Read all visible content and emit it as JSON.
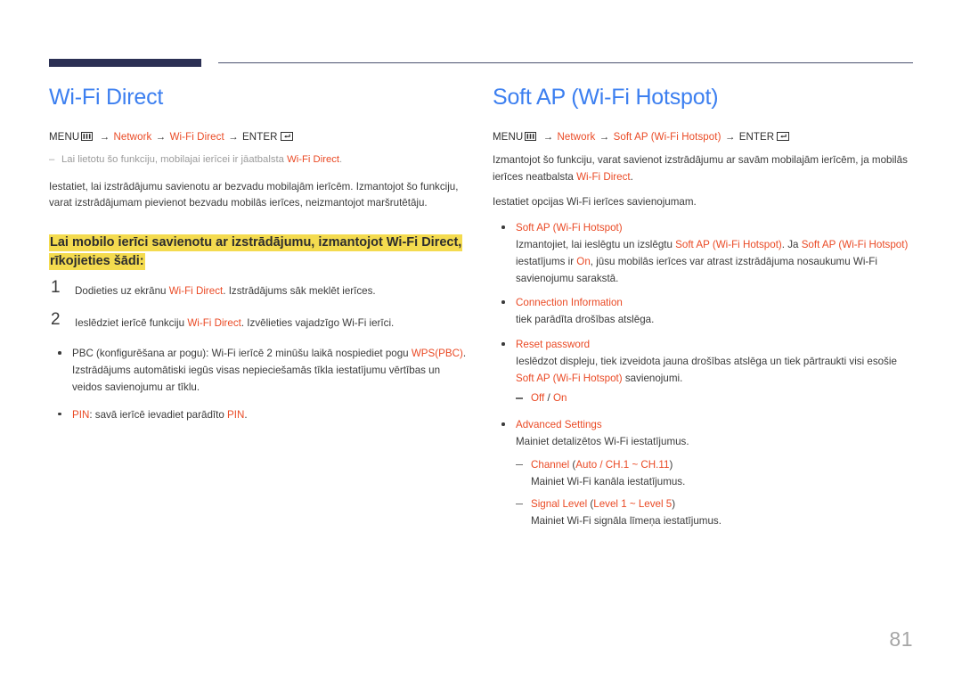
{
  "page": {
    "number": "81",
    "accent_blue": "#3c7ff0",
    "accent_orange": "#ea4a25",
    "highlight_yellow": "#f4db4f",
    "rule_navy": "#2b3054"
  },
  "icons": {
    "menu": "menu-grid-icon",
    "enter": "enter-return-icon"
  },
  "left": {
    "title": "Wi-Fi Direct",
    "menu_path": {
      "label_menu": "MENU",
      "arrow": "→",
      "item1": "Network",
      "item2": "Wi-Fi Direct",
      "label_enter": "ENTER"
    },
    "note": {
      "dash": "‒",
      "text_before": "Lai lietotu šo funkciju, mobilajai ierīcei ir jāatbalsta ",
      "term": "Wi-Fi Direct",
      "text_after": "."
    },
    "intro": "Iestatiet, lai izstrādājumu savienotu ar bezvadu mobilajām ierīcēm. Izmantojot šo funkciju, varat izstrādājumam pievienot bezvadu mobilās ierīces, neizmantojot maršrutētāju.",
    "highlight_heading": "Lai mobilo ierīci savienotu ar izstrādājumu, izmantojot Wi-Fi Direct, rīkojieties šādi:",
    "steps": [
      {
        "num": "1",
        "text_before": "Dodieties uz ekrānu ",
        "term": "Wi-Fi Direct",
        "text_after": ". Izstrādājums sāk meklēt ierīces."
      },
      {
        "num": "2",
        "text_before": "Ieslēdziet ierīcē funkciju ",
        "term": "Wi-Fi Direct",
        "text_after": ". Izvēlieties vajadzīgo Wi-Fi ierīci."
      }
    ],
    "bullets": [
      {
        "text_before": "PBC (konfigurēšana ar pogu): Wi-Fi ierīcē 2 minūšu laikā nospiediet pogu ",
        "term": "WPS(PBC)",
        "text_after": ". Izstrādājums automātiski iegūs visas nepieciešamās tīkla iestatījumu vērtības un veidos savienojumu ar tīklu."
      },
      {
        "term_lead": "PIN",
        "text_mid": ": savā ierīcē ievadiet parādīto ",
        "term_tail": "PIN",
        "text_after": "."
      }
    ]
  },
  "right": {
    "title": "Soft AP (Wi-Fi Hotspot)",
    "menu_path": {
      "label_menu": "MENU",
      "arrow": "→",
      "item1": "Network",
      "item2": "Soft AP (Wi-Fi Hotspot)",
      "label_enter": "ENTER"
    },
    "intro_before": "Izmantojot šo funkciju, varat savienot izstrādājumu ar savām mobilajām ierīcēm, ja mobilās ierīces neatbalsta ",
    "intro_term": "Wi-Fi Direct",
    "intro_after": ".",
    "intro2": "Iestatiet opcijas Wi-Fi ierīces savienojumam.",
    "bullets": [
      {
        "term": "Soft AP (Wi-Fi Hotspot)",
        "d1": "Izmantojiet, lai ieslēgtu un izslēgtu ",
        "d2": "Soft AP (Wi-Fi Hotspot)",
        "d3": ". Ja ",
        "d4": "Soft AP (Wi-Fi Hotspot)",
        "d5": " iestatījums ir ",
        "d6": "On",
        "d7": ", jūsu mobilās ierīces var atrast izstrādājuma nosaukumu Wi-Fi savienojumu sarakstā."
      },
      {
        "term": "Connection Information",
        "desc": "tiek parādīta drošības atslēga."
      },
      {
        "term": "Reset password",
        "d1": "Ieslēdzot displeju, tiek izveidota jauna drošības atslēga un tiek pārtraukti visi esošie ",
        "d2": "Soft AP (Wi-Fi Hotspot)",
        "d3": " savienojumi.",
        "sub": [
          {
            "opt1": "Off",
            "sep": " / ",
            "opt2": "On"
          }
        ]
      },
      {
        "term": "Advanced Settings",
        "desc": "Mainiet detalizētos Wi-Fi iestatījumus.",
        "sub": [
          {
            "name": "Channel",
            "paren_open": " (",
            "values": "Auto / CH.1 ~ CH.11",
            "paren_close": ")",
            "desc": "Mainiet Wi-Fi kanāla iestatījumus."
          },
          {
            "name": "Signal Level",
            "paren_open": " (",
            "values": "Level 1 ~ Level 5",
            "paren_close": ")",
            "desc": "Mainiet Wi-Fi signāla līmeņa iestatījumus."
          }
        ]
      }
    ]
  }
}
